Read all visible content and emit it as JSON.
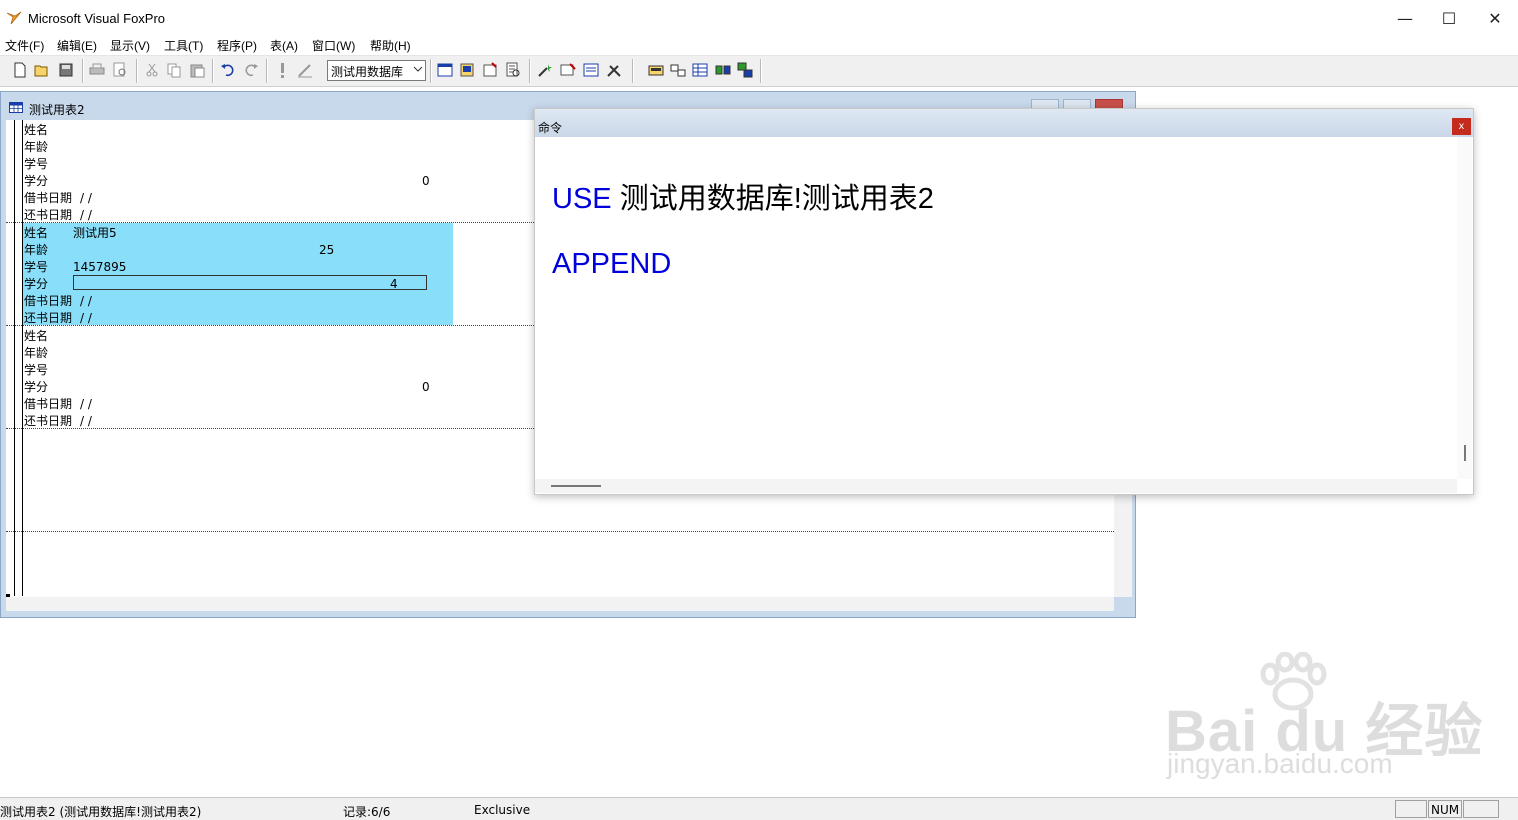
{
  "window": {
    "title": "Microsoft Visual FoxPro",
    "minimize": "—",
    "maximize": "☐",
    "close": "✕"
  },
  "menu": [
    "文件(F)",
    "编辑(E)",
    "显示(V)",
    "工具(T)",
    "程序(P)",
    "表(A)",
    "窗口(W)",
    "帮助(H)"
  ],
  "toolbar": {
    "database_combo": "测试用数据库"
  },
  "table_window": {
    "title": "测试用表2",
    "records": [
      {
        "fields": [
          {
            "label": "姓名",
            "value": ""
          },
          {
            "label": "年龄",
            "value": ""
          },
          {
            "label": "学号",
            "value": ""
          },
          {
            "label": "学分",
            "value": "0"
          },
          {
            "label": "借书日期",
            "value": "/ /"
          },
          {
            "label": "还书日期",
            "value": "/ /"
          }
        ]
      },
      {
        "fields": [
          {
            "label": "姓名",
            "value": "测试用5"
          },
          {
            "label": "年龄",
            "value": "25"
          },
          {
            "label": "学号",
            "value": "1457895"
          },
          {
            "label": "学分",
            "value": "4"
          },
          {
            "label": "借书日期",
            "value": "/ /"
          },
          {
            "label": "还书日期",
            "value": "/ /"
          }
        ]
      },
      {
        "fields": [
          {
            "label": "姓名",
            "value": ""
          },
          {
            "label": "年龄",
            "value": ""
          },
          {
            "label": "学号",
            "value": ""
          },
          {
            "label": "学分",
            "value": "0"
          },
          {
            "label": "借书日期",
            "value": "/ /"
          },
          {
            "label": "还书日期",
            "value": "/ /"
          }
        ]
      }
    ]
  },
  "command_window": {
    "title": "命令",
    "close": "x",
    "lines": [
      {
        "keyword": "USE",
        "rest": " 测试用数据库!测试用表2"
      },
      {
        "keyword": "APPEND",
        "rest": ""
      }
    ]
  },
  "statusbar": {
    "table": "测试用表2 (测试用数据库!测试用表2)",
    "record": "记录:6/6",
    "mode": "Exclusive",
    "num": "NUM"
  },
  "watermark": {
    "main": "Bai du 经验",
    "sub": "jingyan.baidu.com"
  },
  "colors": {
    "highlight": "#89def9",
    "keyword": "#0000dd",
    "close_red": "#c42b1c"
  }
}
